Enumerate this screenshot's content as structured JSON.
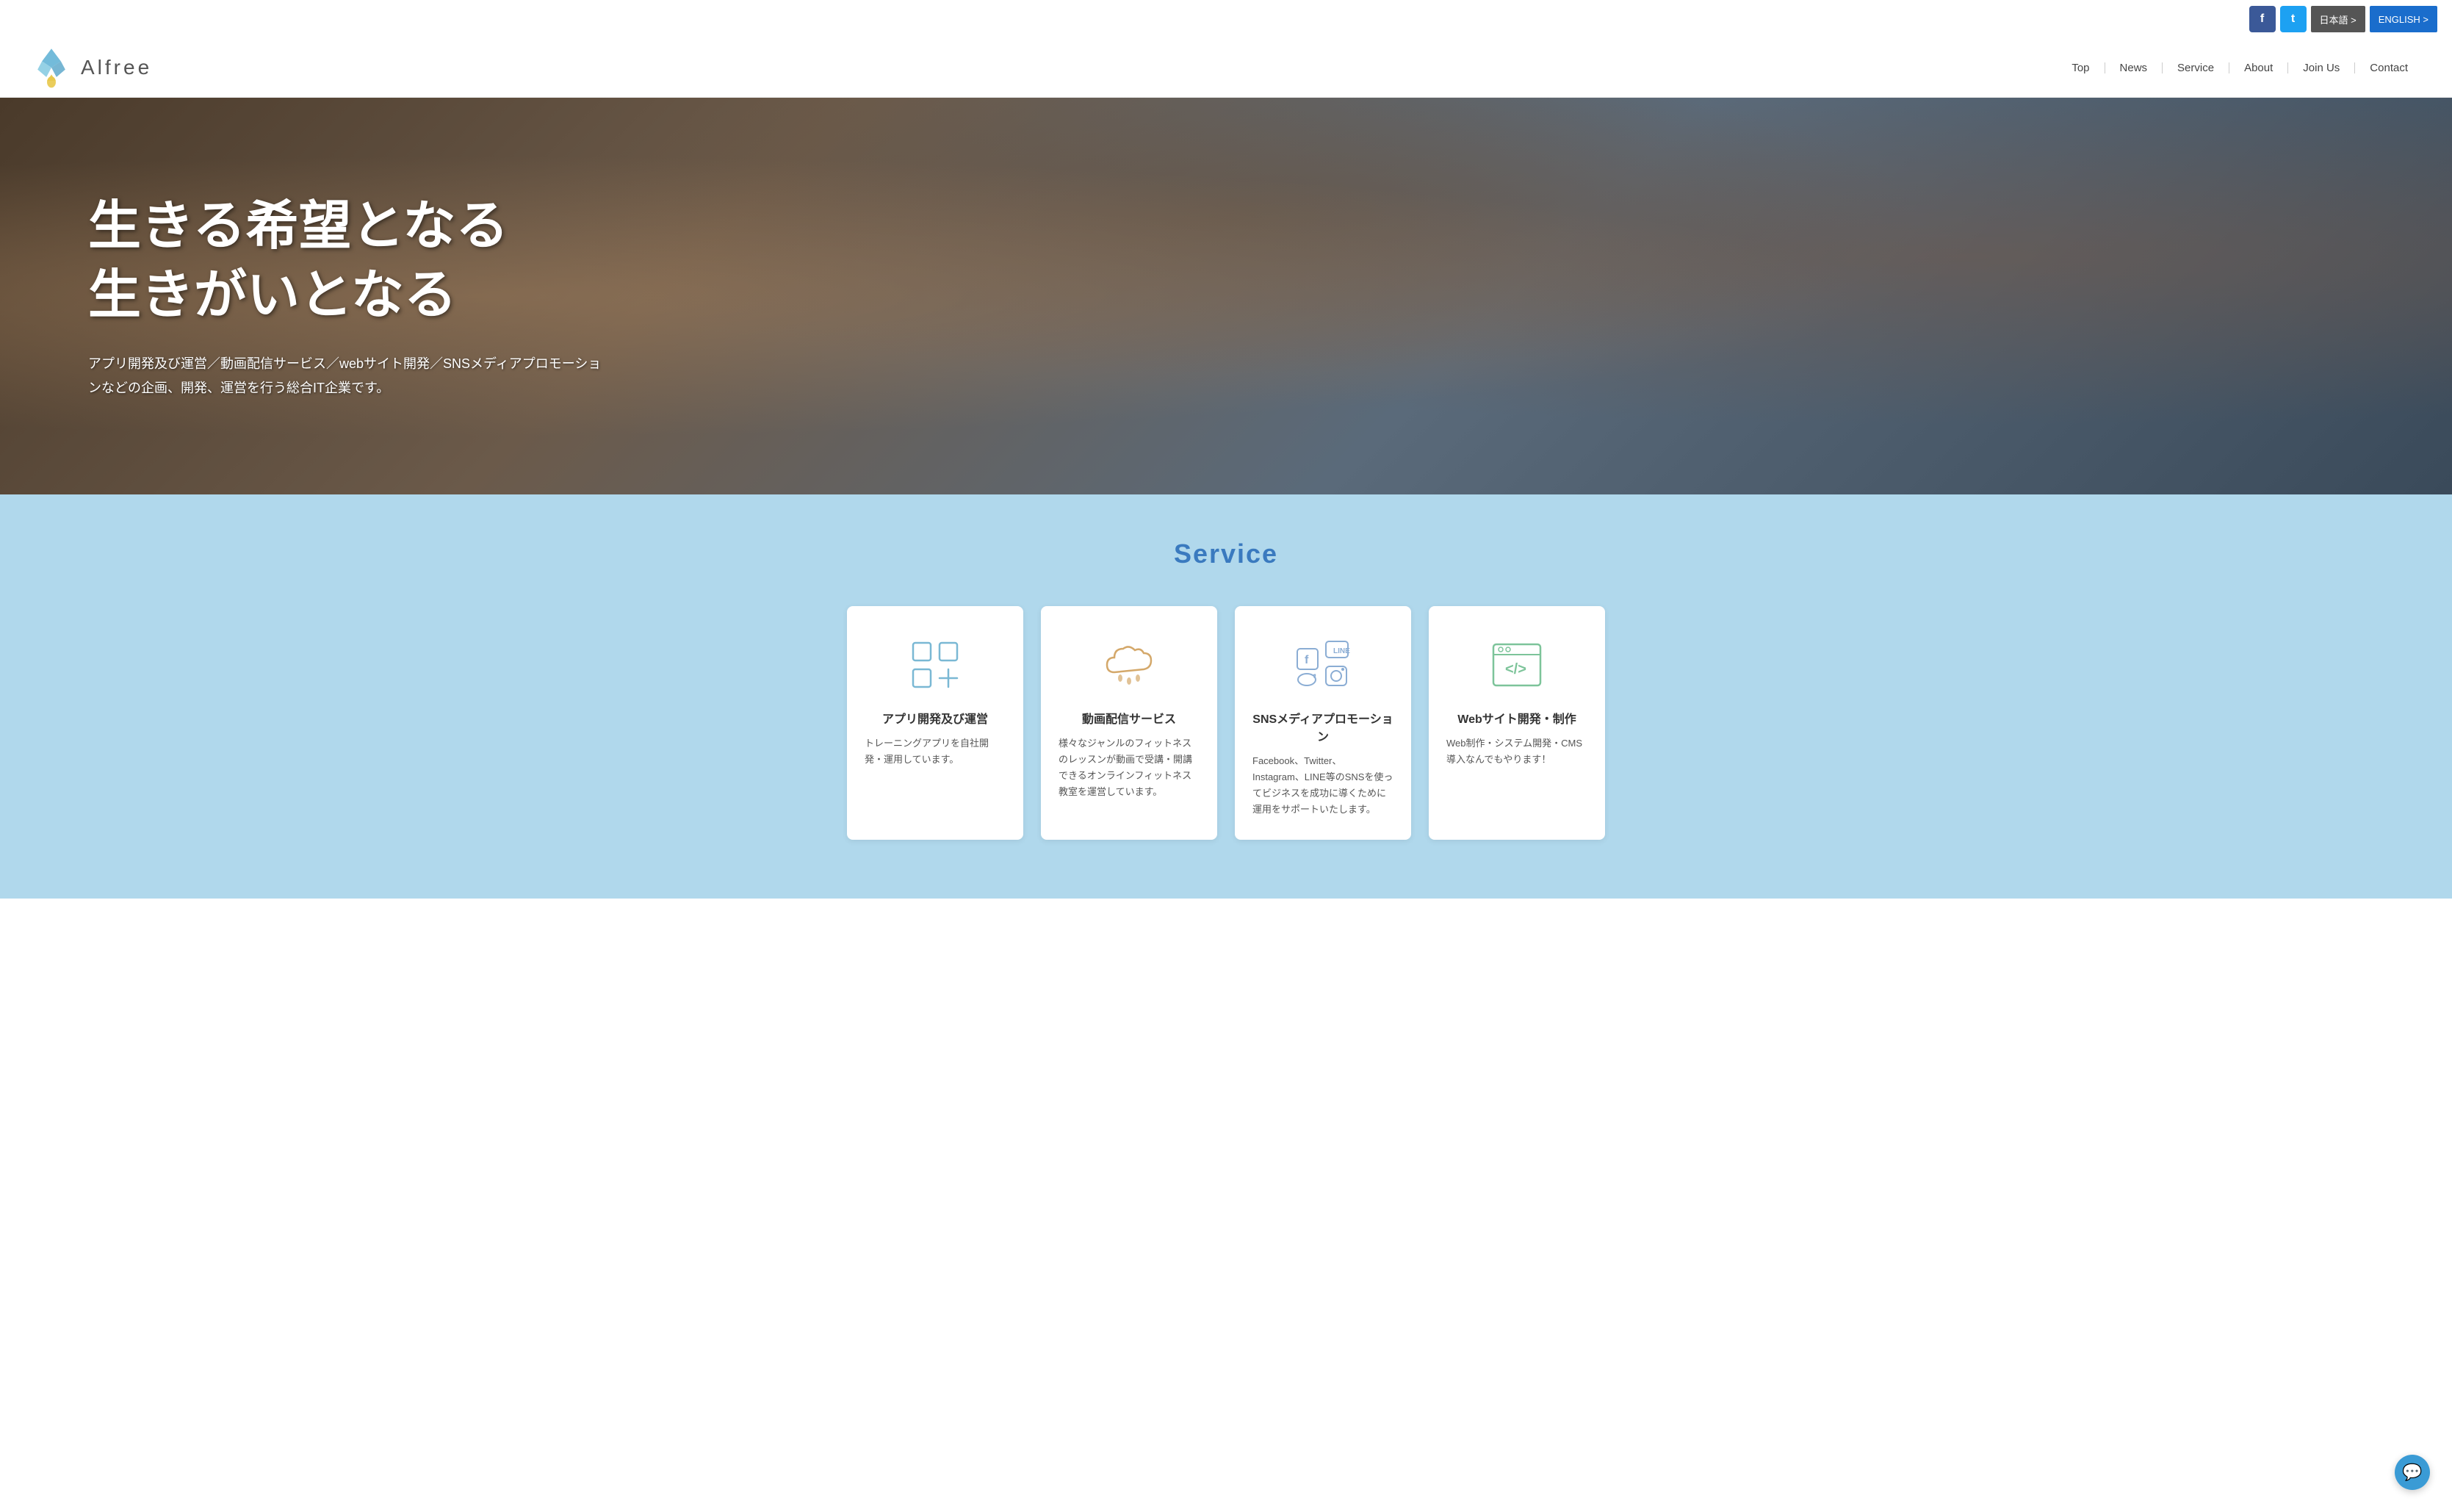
{
  "topbar": {
    "facebook_label": "f",
    "twitter_label": "t",
    "japanese_label": "日本語 >",
    "english_label": "ENGLISH >"
  },
  "header": {
    "logo_text": "Alfree",
    "nav": {
      "top": "Top",
      "news": "News",
      "service": "Service",
      "about": "About",
      "join_us": "Join Us",
      "contact": "Contact"
    }
  },
  "hero": {
    "title_line1": "生きる希望となる",
    "title_line2": "生きがいとなる",
    "subtitle": "アプリ開発及び運営／動画配信サービス／webサイト開発／SNSメディアプロモーションなどの企画、開発、運営を行う総合IT企業です。"
  },
  "service_section": {
    "title": "Service",
    "cards": [
      {
        "id": "app",
        "title": "アプリ開発及び運営",
        "description": "トレーニングアプリを自社開発・運用しています。",
        "icon_type": "app"
      },
      {
        "id": "video",
        "title": "動画配信サービス",
        "description": "様々なジャンルのフィットネスのレッスンが動画で受講・開講できるオンラインフィットネス教室を運営しています。",
        "icon_type": "video"
      },
      {
        "id": "sns",
        "title": "SNSメディアプロモーション",
        "description": "Facebook、Twitter、Instagram、LINE等のSNSを使ってビジネスを成功に導くために運用をサポートいたします。",
        "icon_type": "sns"
      },
      {
        "id": "web",
        "title": "Webサイト開発・制作",
        "description": "Web制作・システム開発・CMS導入なんでもやります！",
        "icon_type": "web"
      }
    ]
  },
  "chat": {
    "icon": "💬"
  }
}
